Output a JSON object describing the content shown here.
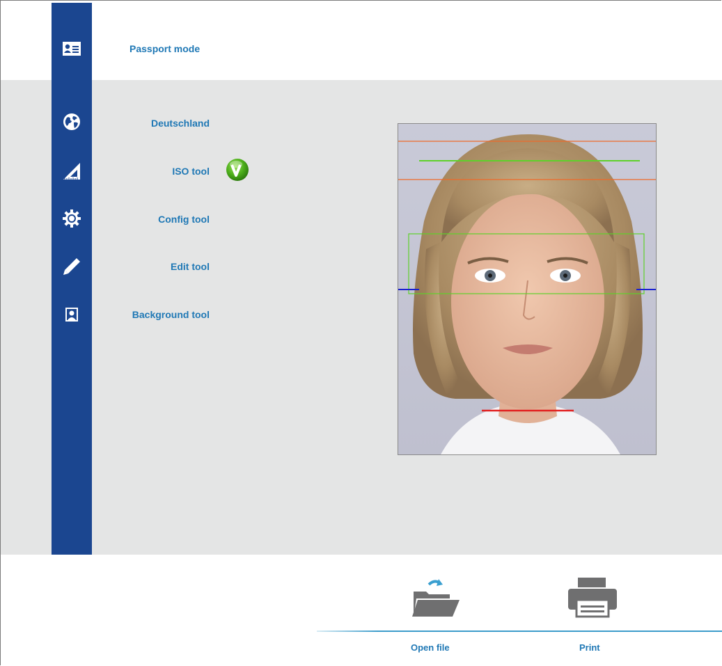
{
  "header": {
    "mode_label": "Passport mode"
  },
  "menu": {
    "country": "Deutschland",
    "iso_tool": "ISO tool",
    "config_tool": "Config tool",
    "edit_tool": "Edit tool",
    "background_tool": "Background tool"
  },
  "actions": {
    "open_file": "Open file",
    "print": "Print"
  },
  "icons": {
    "mode": "id-card-icon",
    "country": "globe-icon",
    "iso": "set-square-icon",
    "config": "gear-icon",
    "edit": "pencil-icon",
    "background": "portrait-icon",
    "iso_status": "check-icon",
    "open_file": "folder-open-icon",
    "print": "printer-icon"
  },
  "colors": {
    "sidebar": "#1b4690",
    "label": "#1f78b5",
    "panel": "#e4e5e5",
    "check_green": "#4cae1a"
  }
}
